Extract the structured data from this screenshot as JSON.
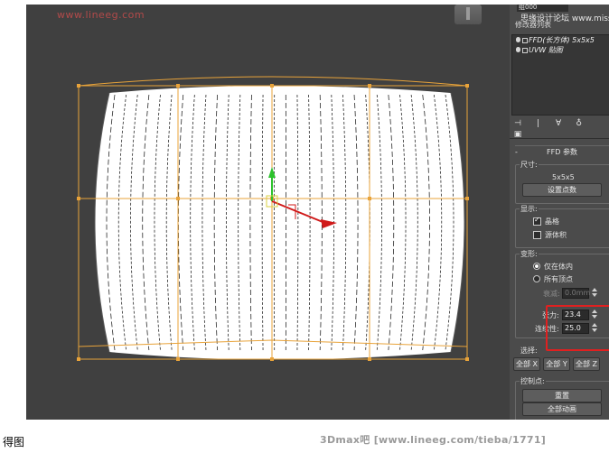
{
  "viewport": {
    "watermark": "www.lineeg.com"
  },
  "command_panel": {
    "object_name": "组000",
    "watermark": "思缘设计论坛 www.missyuan.com",
    "modifier_list_label": "修改器列表",
    "stack_items": [
      "FFD(长方体) 5x5x5",
      "UVW 贴图"
    ],
    "stack_toolbar_icons": [
      "pin-stack-icon",
      "show-end-result-icon",
      "make-unique-icon",
      "remove-modifier-icon",
      "configure-sets-icon"
    ]
  },
  "ffd_params": {
    "rollout_title": "FFD 参数",
    "dimensions": {
      "group": "尺寸:",
      "value": "5x5x5",
      "set_points_button": "设置点数"
    },
    "display": {
      "group": "显示:",
      "lattice_label": "晶格",
      "lattice_checked": true,
      "source_volume_label": "源体积",
      "source_volume_checked": false
    },
    "deform": {
      "group": "变形:",
      "inside_only_label": "仅在体内",
      "all_vertices_label": "所有顶点",
      "selected": "inside_only",
      "falloff_label": "衰减:",
      "falloff_value": "0.0mm",
      "tension_label": "张力:",
      "tension_value": "23.4",
      "continuity_label": "连续性:",
      "continuity_value": "25.0"
    },
    "select": {
      "group": "选择:",
      "buttons": [
        "全部 X",
        "全部 Y",
        "全部 Z"
      ]
    },
    "control_points": {
      "group": "控制点:",
      "reset_button": "重置",
      "animate_all_button": "全部动画"
    }
  },
  "page": {
    "caption": "得图",
    "credit": "3Dmax吧 [www.lineeg.com/tieba/1771]"
  },
  "colors": {
    "viewport_bg": "#404040",
    "panel_bg": "#4b4b4b",
    "lattice": "#e8a33a",
    "highlight": "#e02020",
    "mesh": "#ffffff"
  }
}
